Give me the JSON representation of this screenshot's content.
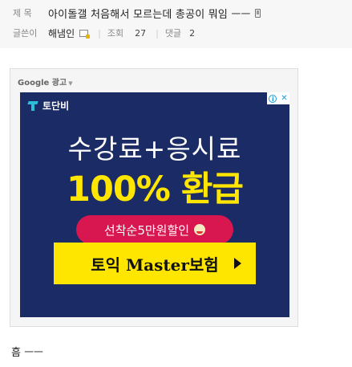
{
  "post": {
    "title_label": "제 목",
    "title": "아이돌갤 처음해서 모르는데 총공이 뭐임 ㅡㅡ",
    "author_label": "글쓴이",
    "author": "해냄인",
    "views_label": "조회",
    "views": "27",
    "comments_label": "댓글",
    "comments": "2",
    "body": "흠 ㅡㅡ"
  },
  "ad": {
    "label": "Google 광고",
    "brand": "토단비",
    "headline": "수강료+응시료",
    "highlight": "100% 환급",
    "pill": "선착순5만원할인",
    "cta": "토익 Master보험",
    "adchoices_i": "i",
    "adchoices_x": "✕",
    "colors": {
      "bg": "#1a2b66",
      "yellow": "#ffe600",
      "pink": "#d8164f"
    }
  }
}
